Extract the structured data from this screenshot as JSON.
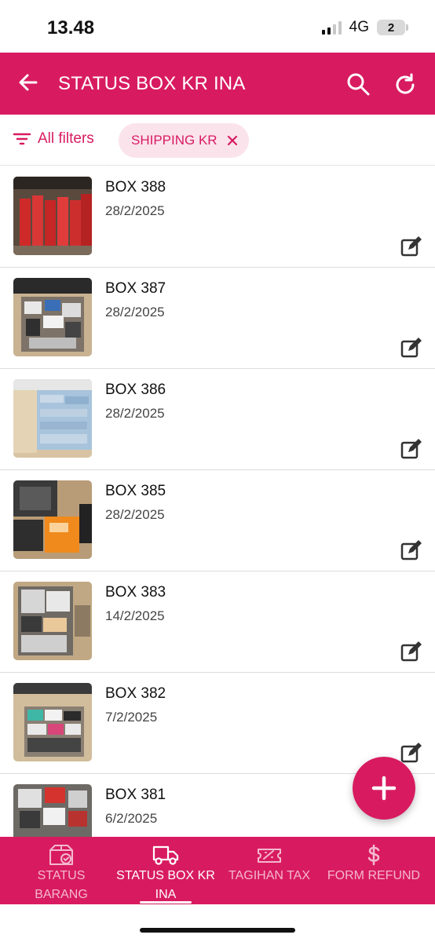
{
  "status_bar": {
    "time": "13.48",
    "network": "4G",
    "battery": "2"
  },
  "header": {
    "title": "STATUS BOX KR INA",
    "color": "#d81b60"
  },
  "filters": {
    "all_filters_label": "All filters",
    "chip_label": "SHIPPING KR"
  },
  "rows": [
    {
      "title": "BOX 388",
      "date": "28/2/2025",
      "thumb_theme": "red-bags"
    },
    {
      "title": "BOX 387",
      "date": "28/2/2025",
      "thumb_theme": "mixed-packages"
    },
    {
      "title": "BOX 386",
      "date": "28/2/2025",
      "thumb_theme": "blue-packs"
    },
    {
      "title": "BOX 385",
      "date": "28/2/2025",
      "thumb_theme": "orange-bag"
    },
    {
      "title": "BOX 383",
      "date": "14/2/2025",
      "thumb_theme": "mixed-packages"
    },
    {
      "title": "BOX 382",
      "date": "7/2/2025",
      "thumb_theme": "colorful-boxes"
    },
    {
      "title": "BOX 381",
      "date": "6/2/2025",
      "thumb_theme": "red-boxes"
    }
  ],
  "nav": [
    {
      "label_line1": "STATUS",
      "label_line2": "BARANG",
      "icon": "box-check-icon",
      "active": false
    },
    {
      "label_line1": "STATUS BOX KR",
      "label_line2": "INA",
      "icon": "truck-icon",
      "active": true
    },
    {
      "label_line1": "TAGIHAN TAX",
      "label_line2": "",
      "icon": "ticket-icon",
      "active": false
    },
    {
      "label_line1": "FORM REFUND",
      "label_line2": "",
      "icon": "dollar-icon",
      "active": false
    }
  ]
}
